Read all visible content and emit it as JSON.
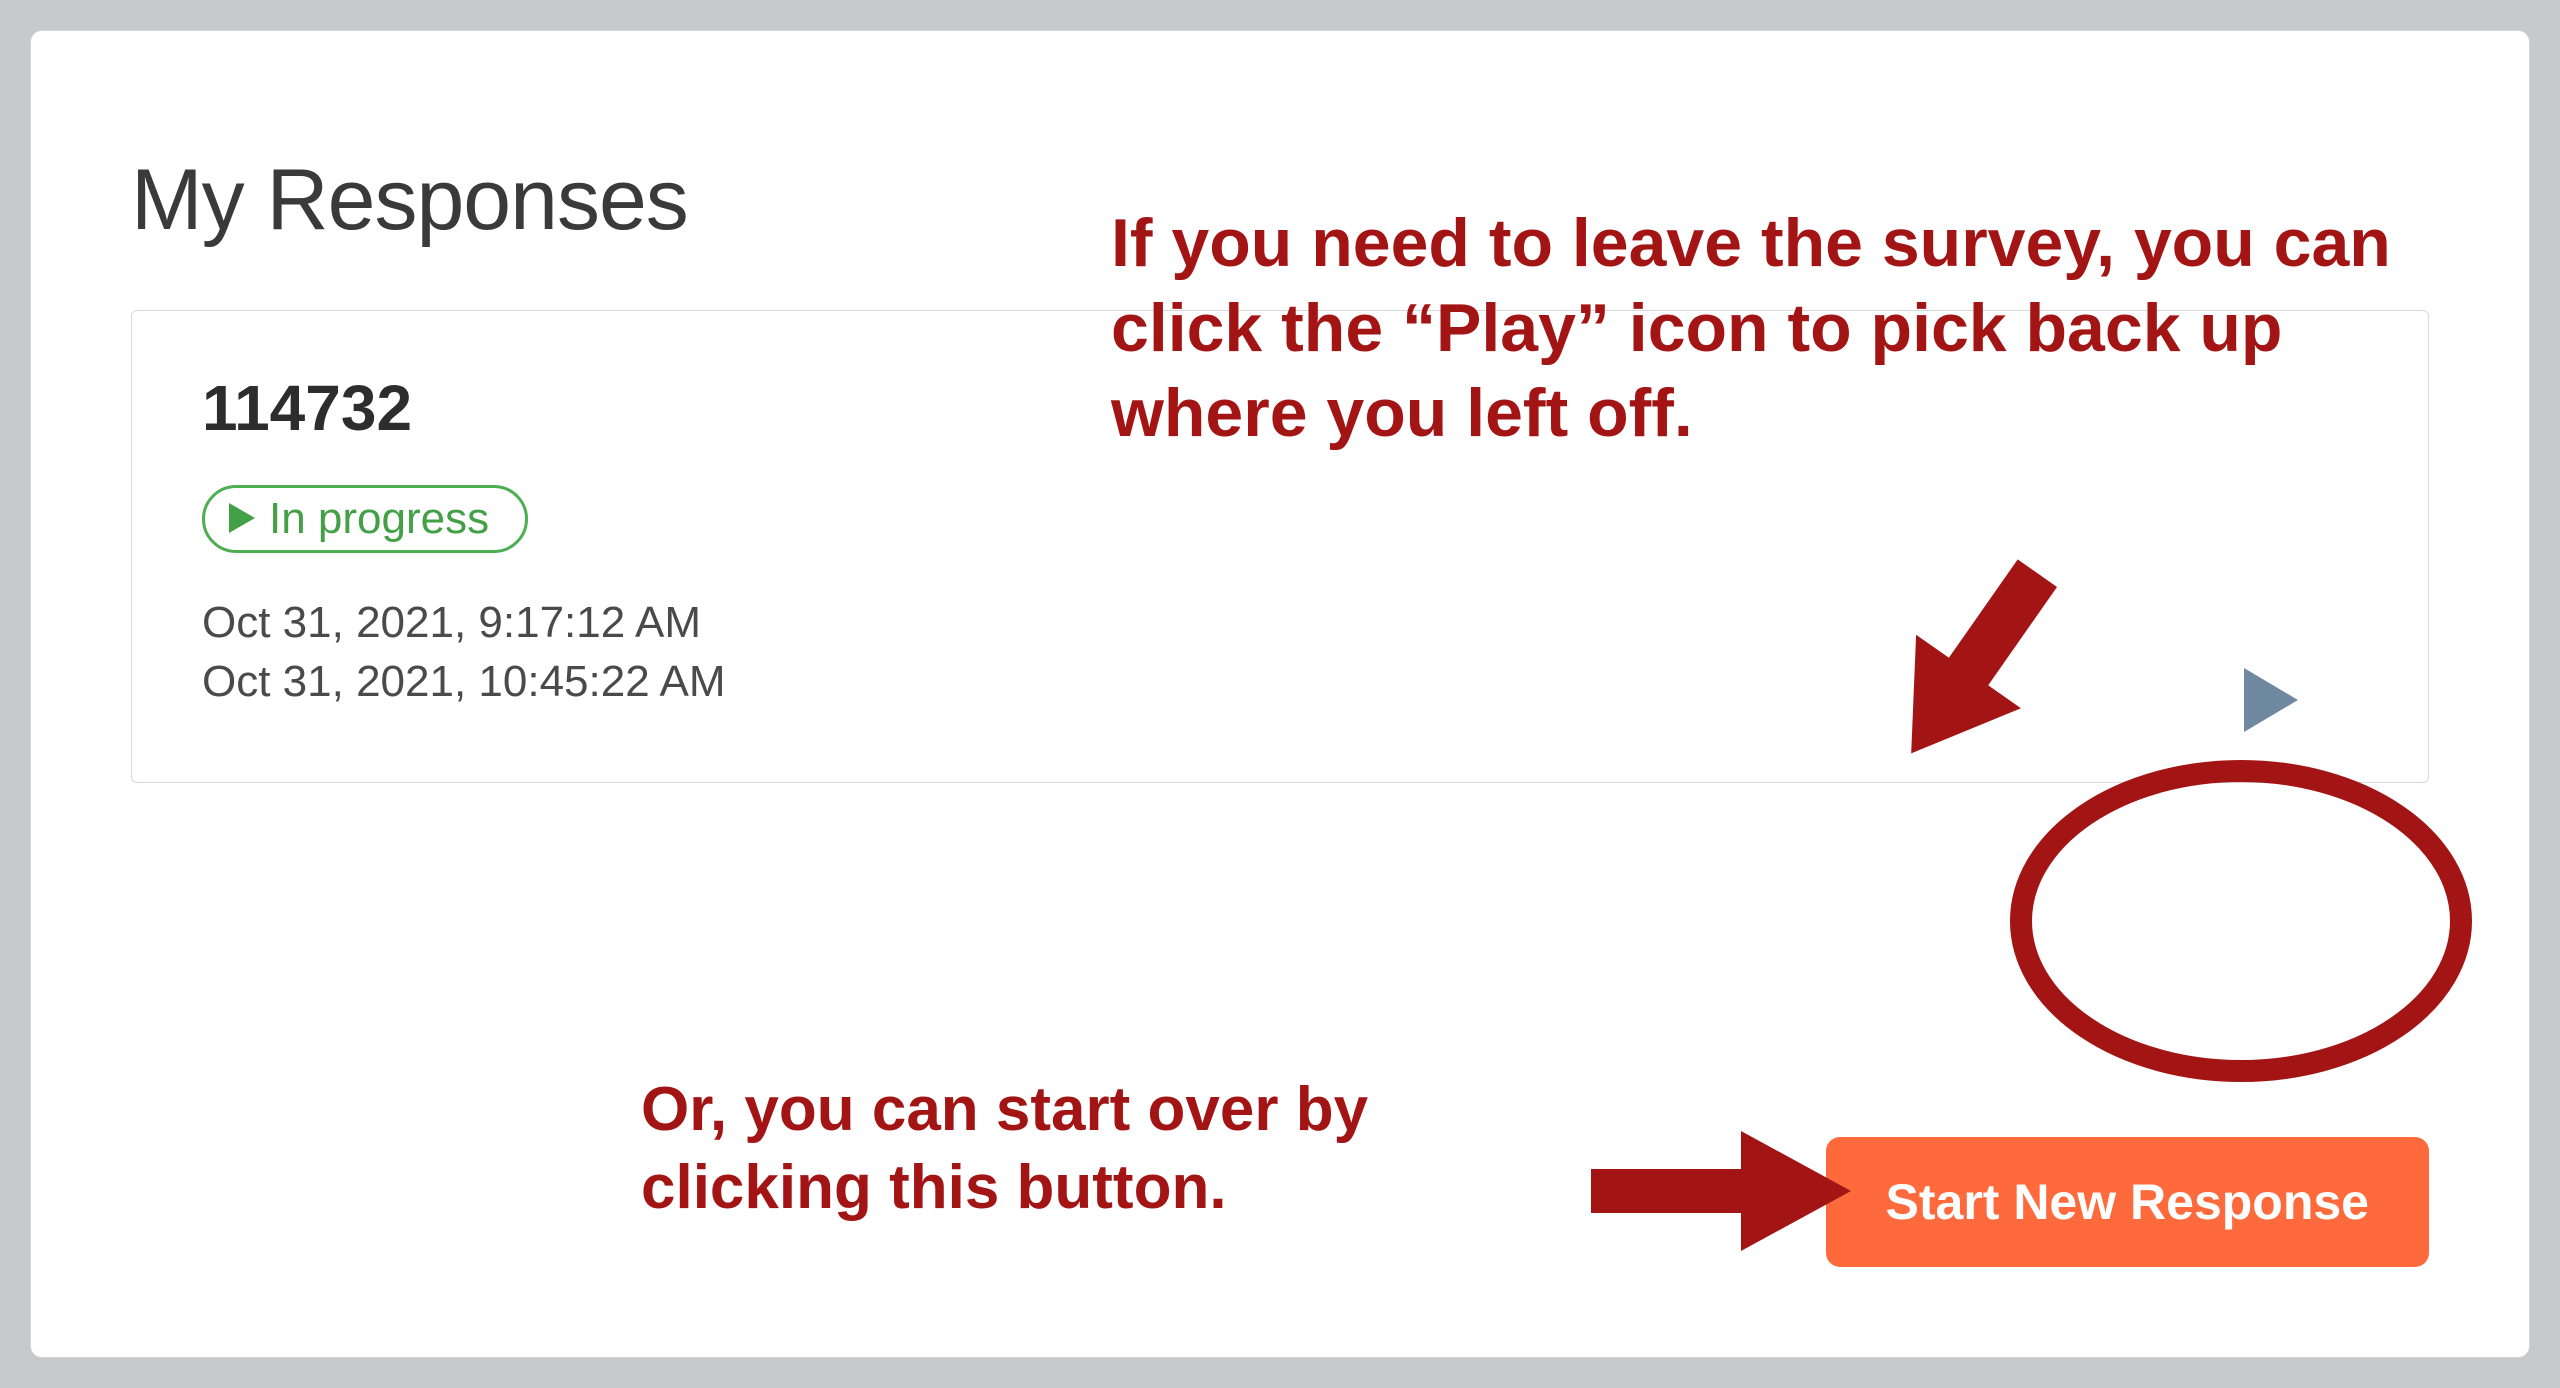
{
  "page": {
    "title": "My Responses"
  },
  "response": {
    "id": "114732",
    "status_label": "In progress",
    "timestamp_start": "Oct 31, 2021, 9:17:12 AM",
    "timestamp_end": "Oct 31, 2021, 10:45:22 AM"
  },
  "actions": {
    "start_new_label": "Start New Response"
  },
  "annotations": {
    "top": "If you  need to leave the survey, you can click the “Play” icon to pick back up where you left off.",
    "bottom": "Or, you can start over by clicking this button.",
    "accent_color": "#a31515"
  },
  "colors": {
    "status_green": "#43a047",
    "button_orange": "#ff6a3d",
    "play_icon_blue": "#6f8aa0"
  }
}
